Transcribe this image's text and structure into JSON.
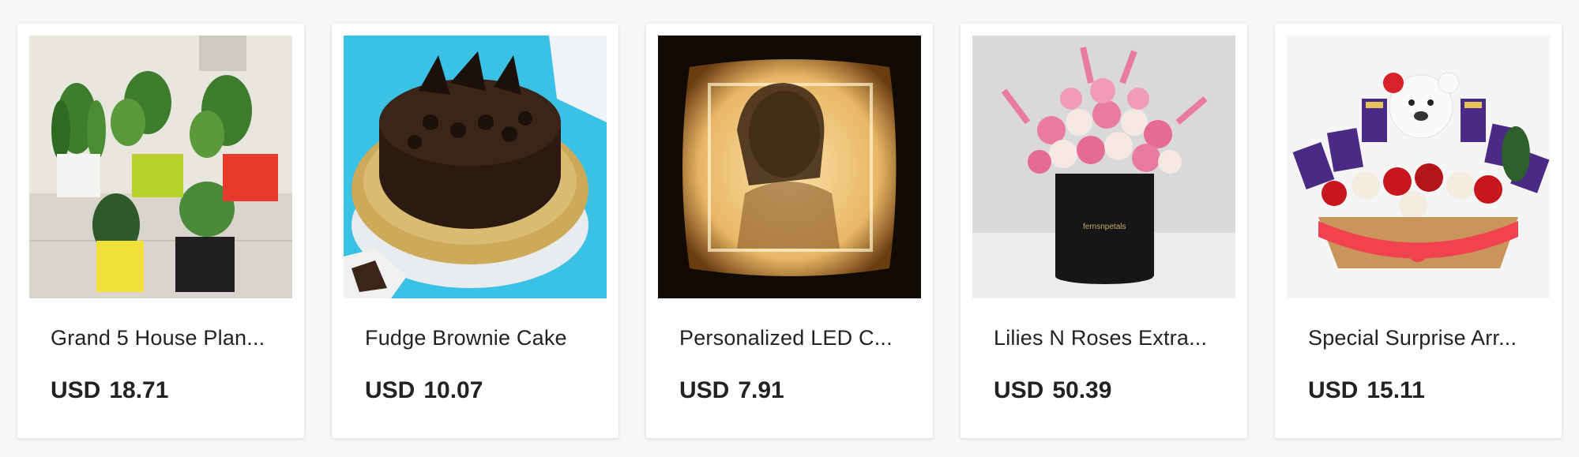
{
  "products": [
    {
      "name": "Grand 5 House Plan...",
      "currency": "USD",
      "price": "18.71",
      "image": "house-plants-image"
    },
    {
      "name": "Fudge Brownie Cake",
      "currency": "USD",
      "price": "10.07",
      "image": "chocolate-cake-image"
    },
    {
      "name": "Personalized LED C...",
      "currency": "USD",
      "price": "7.91",
      "image": "led-cushion-image"
    },
    {
      "name": "Lilies N Roses Extra...",
      "currency": "USD",
      "price": "50.39",
      "image": "flower-box-image"
    },
    {
      "name": "Special Surprise Arr...",
      "currency": "USD",
      "price": "15.11",
      "image": "gift-basket-image"
    }
  ]
}
